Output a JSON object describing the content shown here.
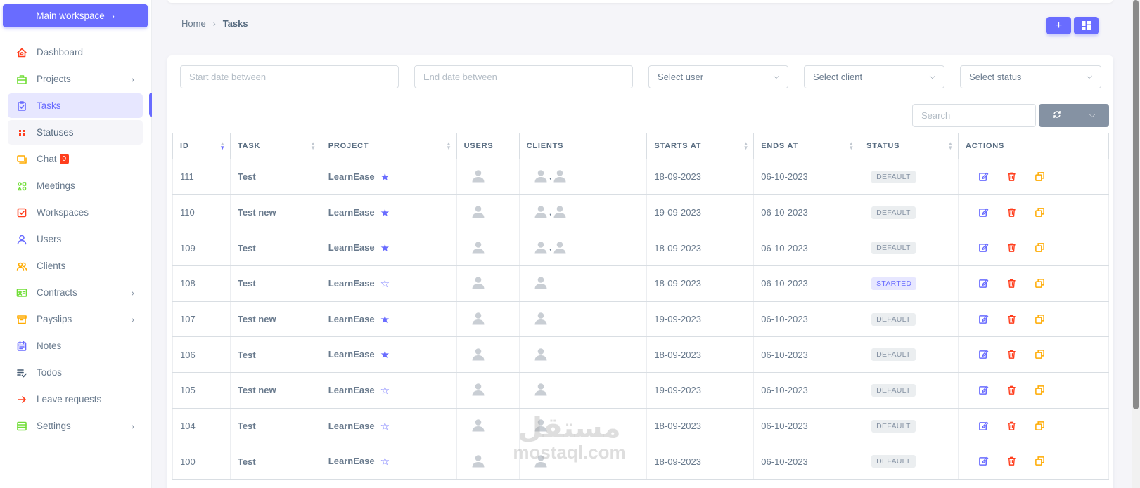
{
  "sidebar": {
    "workspace_button": "Main workspace",
    "items": [
      {
        "label": "Dashboard",
        "icon": "home-icon",
        "color": "#ff3e1d",
        "arrow": false
      },
      {
        "label": "Projects",
        "icon": "briefcase-icon",
        "color": "#71dd37",
        "arrow": true
      },
      {
        "label": "Tasks",
        "icon": "task-icon",
        "color": "#696cff",
        "arrow": false,
        "active": true
      },
      {
        "label": "Statuses",
        "icon": "grid-icon",
        "color": "#ff3e1d",
        "arrow": false,
        "sub": true
      },
      {
        "label": "Chat",
        "icon": "chat-icon",
        "color": "#ffab00",
        "arrow": false,
        "badge": "0"
      },
      {
        "label": "Meetings",
        "icon": "shapes-icon",
        "color": "#71dd37",
        "arrow": false
      },
      {
        "label": "Workspaces",
        "icon": "check-square-icon",
        "color": "#ff3e1d",
        "arrow": false
      },
      {
        "label": "Users",
        "icon": "user-icon",
        "color": "#696cff",
        "arrow": false
      },
      {
        "label": "Clients",
        "icon": "group-icon",
        "color": "#ffab00",
        "arrow": false
      },
      {
        "label": "Contracts",
        "icon": "id-card-icon",
        "color": "#71dd37",
        "arrow": true
      },
      {
        "label": "Payslips",
        "icon": "box-icon",
        "color": "#ffab00",
        "arrow": true
      },
      {
        "label": "Notes",
        "icon": "calendar-note-icon",
        "color": "#696cff",
        "arrow": false
      },
      {
        "label": "Todos",
        "icon": "list-check-icon",
        "color": "#435971",
        "arrow": false
      },
      {
        "label": "Leave requests",
        "icon": "arrow-right-icon",
        "color": "#ff3e1d",
        "arrow": false
      },
      {
        "label": "Settings",
        "icon": "settings-box-icon",
        "color": "#71dd37",
        "arrow": true
      }
    ]
  },
  "breadcrumb": {
    "home": "Home",
    "current": "Tasks"
  },
  "filters": {
    "start_date_placeholder": "Start date between",
    "end_date_placeholder": "End date between",
    "user": "Select user",
    "client": "Select client",
    "status": "Select status",
    "search_placeholder": "Search"
  },
  "table": {
    "headers": [
      "ID",
      "TASK",
      "PROJECT",
      "USERS",
      "CLIENTS",
      "STARTS AT",
      "ENDS AT",
      "STATUS",
      "ACTIONS"
    ],
    "rows": [
      {
        "id": "111",
        "task": "Test",
        "project": "LearnEase",
        "fav": true,
        "clients": 2,
        "starts": "18-09-2023",
        "ends": "06-10-2023",
        "status": "DEFAULT"
      },
      {
        "id": "110",
        "task": "Test new",
        "project": "LearnEase",
        "fav": true,
        "clients": 2,
        "starts": "19-09-2023",
        "ends": "06-10-2023",
        "status": "DEFAULT"
      },
      {
        "id": "109",
        "task": "Test",
        "project": "LearnEase",
        "fav": true,
        "clients": 2,
        "starts": "18-09-2023",
        "ends": "06-10-2023",
        "status": "DEFAULT"
      },
      {
        "id": "108",
        "task": "Test",
        "project": "LearnEase",
        "fav": false,
        "clients": 1,
        "starts": "18-09-2023",
        "ends": "06-10-2023",
        "status": "STARTED"
      },
      {
        "id": "107",
        "task": "Test new",
        "project": "LearnEase",
        "fav": true,
        "clients": 1,
        "starts": "19-09-2023",
        "ends": "06-10-2023",
        "status": "DEFAULT"
      },
      {
        "id": "106",
        "task": "Test",
        "project": "LearnEase",
        "fav": true,
        "clients": 1,
        "starts": "18-09-2023",
        "ends": "06-10-2023",
        "status": "DEFAULT"
      },
      {
        "id": "105",
        "task": "Test new",
        "project": "LearnEase",
        "fav": false,
        "clients": 1,
        "starts": "19-09-2023",
        "ends": "06-10-2023",
        "status": "DEFAULT"
      },
      {
        "id": "104",
        "task": "Test",
        "project": "LearnEase",
        "fav": false,
        "clients": 1,
        "starts": "18-09-2023",
        "ends": "06-10-2023",
        "status": "DEFAULT"
      },
      {
        "id": "100",
        "task": "Test",
        "project": "LearnEase",
        "fav": false,
        "clients": 1,
        "starts": "18-09-2023",
        "ends": "06-10-2023",
        "status": "DEFAULT"
      }
    ]
  },
  "watermark": {
    "arabic": "مستقل",
    "latin": "mostaql.com"
  },
  "colors": {
    "primary": "#696cff",
    "danger": "#ff3e1d",
    "warning": "#ffab00",
    "secondary": "#8592a3"
  }
}
